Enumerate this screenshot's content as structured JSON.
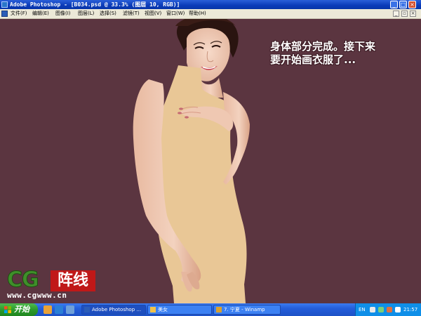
{
  "window": {
    "title": "Adobe Photoshop - [B034.psd @ 33.3% (图层 10, RGB)]",
    "controls": {
      "minimize": "_",
      "maximize": "□",
      "close": "×"
    }
  },
  "menu": {
    "items": [
      "文件(F)",
      "编辑(E)",
      "图像(I)",
      "图层(L)",
      "选择(S)",
      "滤镜(T)",
      "视图(V)",
      "窗口(W)",
      "帮助(H)"
    ],
    "doc_controls": {
      "minimize": "_",
      "restore": "▫",
      "close": "×"
    }
  },
  "canvas": {
    "background_color": "#5b3540",
    "caption_line1": "身体部分完成。接下来",
    "caption_line2": "要开始画衣服了..."
  },
  "logo": {
    "letters": "CG",
    "chinese": "阵线",
    "url": "www.cgwww.cn"
  },
  "taskbar": {
    "start_label": "开始",
    "tasks": [
      {
        "label": "Adobe Photoshop ...",
        "icon": "photoshop-icon",
        "active": true
      },
      {
        "label": "美女",
        "icon": "folder-icon",
        "active": false
      },
      {
        "label": "7. 宁夏 - Winamp",
        "icon": "winamp-icon",
        "active": false
      }
    ],
    "tray": {
      "language": "EN",
      "time": "21:57"
    }
  },
  "colors": {
    "titlebar": "#0a3bb8",
    "taskbar": "#245edb",
    "start_button": "#2c9a2c",
    "tray": "#0f8fe8",
    "skin_placeholder": "#e9c796"
  }
}
